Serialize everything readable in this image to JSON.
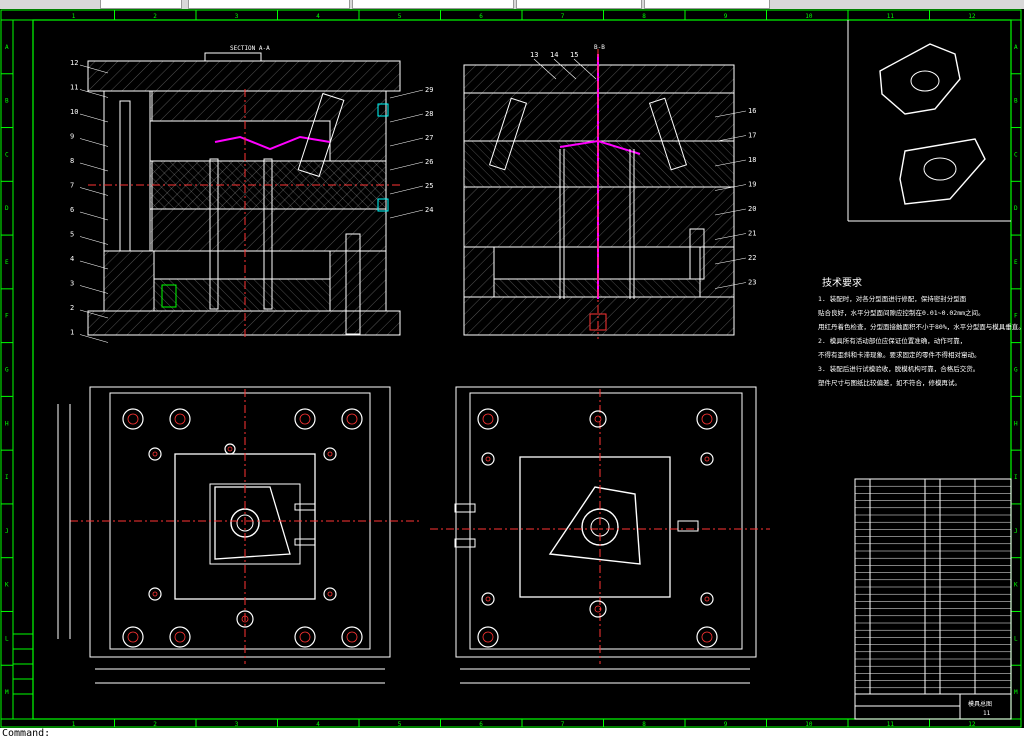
{
  "top_strip": {
    "tabs": [
      "",
      "",
      "",
      "",
      ""
    ]
  },
  "drawing": {
    "section_titles": {
      "left": "SECTION A-A",
      "right": "B-B"
    },
    "zone_columns": [
      "1",
      "2",
      "3",
      "4",
      "5",
      "6",
      "7",
      "8",
      "9",
      "10",
      "11",
      "12"
    ],
    "zone_rows": [
      "A",
      "B",
      "C",
      "D",
      "E",
      "F",
      "G",
      "H",
      "I",
      "J",
      "K",
      "L",
      "M"
    ],
    "left_callouts": [
      "12",
      "11",
      "10",
      "9",
      "8",
      "7",
      "6",
      "5",
      "4",
      "3",
      "2",
      "1"
    ],
    "mid_callouts": [
      "29",
      "28",
      "27",
      "26",
      "25",
      "24"
    ],
    "right_top_callouts": [
      "13",
      "14",
      "15"
    ],
    "right_callouts": [
      "16",
      "17",
      "18",
      "19",
      "20",
      "21",
      "22",
      "23"
    ],
    "tech": {
      "title": "技术要求",
      "lines": [
        "1. 装配时，对各分型面进行修配，保持密封分型面",
        "贴合良好，水平分型面间隙应控制在0.01~0.02mm之间。",
        "用红丹着色检查，分型面接触面积不小于80%，水平分型面与模具垂直。",
        "2. 模具所有活动部位应保证位置准确，动作可靠，",
        "不得有歪斜和卡滞现象。要求固定的零件不得相对窜动。",
        "3. 装配后进行试模验收，脱模机构可靠，合格后交货。",
        "塑件尺寸与图纸比较偏差，如不符合，修模再试。"
      ]
    },
    "title_block": {
      "drawing_name": "模具总图",
      "sheet": "11"
    }
  },
  "command_line": {
    "text": "Command: "
  }
}
